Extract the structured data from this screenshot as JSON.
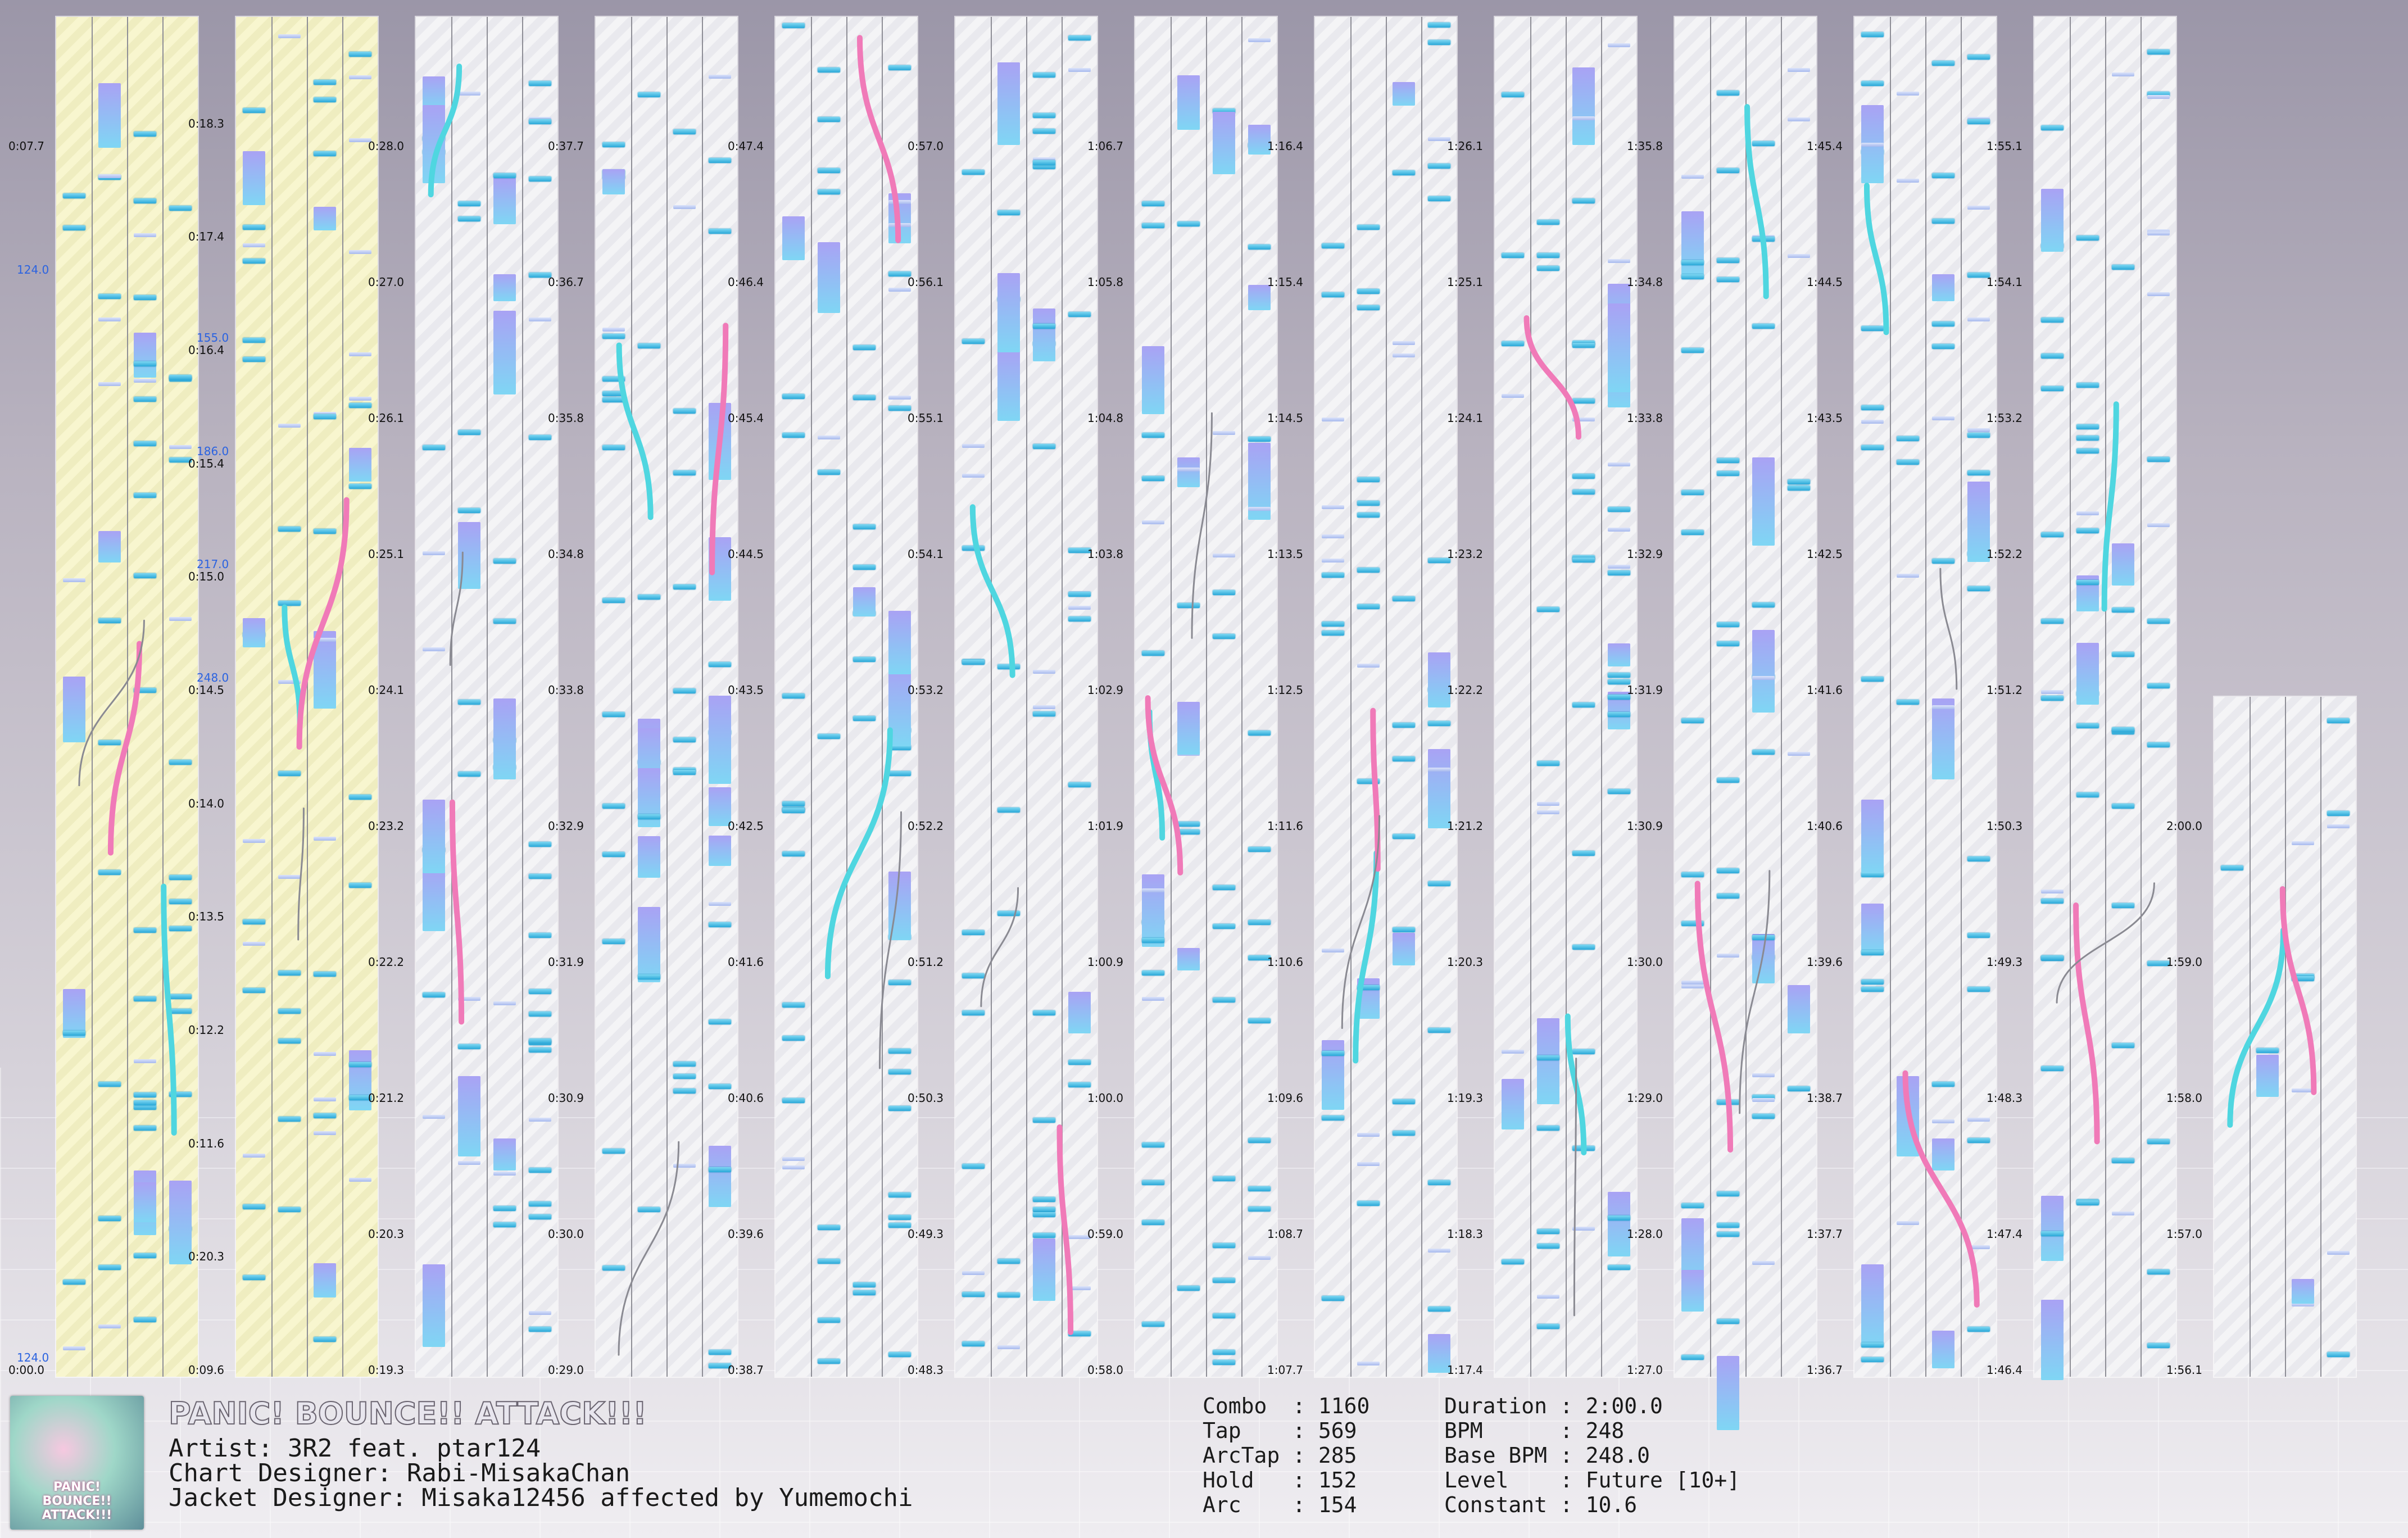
{
  "song": {
    "title": "PANIC! BOUNCE!! ATTACK!!!",
    "artist_line": "Artist: 3R2 feat. ptar124",
    "chart_designer_line": "Chart Designer: Rabi-MisakaChan",
    "jacket_designer_line": "Jacket Designer: Misaka12456 affected by Yumemochi",
    "jacket_text": "PANIC! BOUNCE!! ATTACK!!!"
  },
  "stats_left": [
    {
      "label": "Combo ",
      "value": "1160"
    },
    {
      "label": "Tap   ",
      "value": "569"
    },
    {
      "label": "ArcTap",
      "value": "285"
    },
    {
      "label": "Hold  ",
      "value": "152"
    },
    {
      "label": "Arc   ",
      "value": "154"
    }
  ],
  "stats_right": [
    {
      "label": "Duration",
      "value": "2:00.0"
    },
    {
      "label": "BPM     ",
      "value": "248"
    },
    {
      "label": "Base BPM",
      "value": "248.0"
    },
    {
      "label": "Level   ",
      "value": "Future [10+]"
    },
    {
      "label": "Constant",
      "value": "10.6"
    }
  ],
  "colors": {
    "tap": "#2aa8d8",
    "arc_blue": "#4fd6e0",
    "arc_pink": "#f07ab8",
    "bpm": "#2b63e0",
    "slow_section": "#f8f6cf"
  },
  "bpm_markers": [
    {
      "col": 0,
      "label": "124.0",
      "tick": 2
    },
    {
      "col": 0,
      "label": "124.0",
      "tick": 10
    },
    {
      "col": 1,
      "label": "248.0",
      "tick": 6
    },
    {
      "col": 1,
      "label": "217.0",
      "tick": 5
    },
    {
      "col": 1,
      "label": "186.0",
      "tick": 4
    },
    {
      "col": 1,
      "label": "155.0",
      "tick": 3
    }
  ],
  "columns": [
    {
      "labels": [
        "0:07.7",
        "",
        "",
        "",
        "",
        "",
        "",
        "",
        "",
        "0:00.0"
      ],
      "yellow": true
    },
    {
      "labels": [
        "0:18.3",
        "0:17.4",
        "0:16.4",
        "0:15.4",
        "0:15.0",
        "0:14.5",
        "0:14.0",
        "0:13.5",
        "0:12.2",
        "0:11.6",
        "0:20.3",
        "0:09.6"
      ],
      "yellow": true
    },
    {
      "labels": [
        "0:28.0",
        "0:27.0",
        "0:26.1",
        "0:25.1",
        "0:24.1",
        "0:23.2",
        "0:22.2",
        "0:21.2",
        "0:20.3",
        "0:19.3"
      ]
    },
    {
      "labels": [
        "0:37.7",
        "0:36.7",
        "0:35.8",
        "0:34.8",
        "0:33.8",
        "0:32.9",
        "0:31.9",
        "0:30.9",
        "0:30.0",
        "0:29.0"
      ]
    },
    {
      "labels": [
        "0:47.4",
        "0:46.4",
        "0:45.4",
        "0:44.5",
        "0:43.5",
        "0:42.5",
        "0:41.6",
        "0:40.6",
        "0:39.6",
        "0:38.7"
      ]
    },
    {
      "labels": [
        "0:57.0",
        "0:56.1",
        "0:55.1",
        "0:54.1",
        "0:53.2",
        "0:52.2",
        "0:51.2",
        "0:50.3",
        "0:49.3",
        "0:48.3"
      ]
    },
    {
      "labels": [
        "1:06.7",
        "1:05.8",
        "1:04.8",
        "1:03.8",
        "1:02.9",
        "1:01.9",
        "1:00.9",
        "1:00.0",
        "0:59.0",
        "0:58.0"
      ]
    },
    {
      "labels": [
        "1:16.4",
        "1:15.4",
        "1:14.5",
        "1:13.5",
        "1:12.5",
        "1:11.6",
        "1:10.6",
        "1:09.6",
        "1:08.7",
        "1:07.7"
      ]
    },
    {
      "labels": [
        "1:26.1",
        "1:25.1",
        "1:24.1",
        "1:23.2",
        "1:22.2",
        "1:21.2",
        "1:20.3",
        "1:19.3",
        "1:18.3",
        "1:17.4"
      ]
    },
    {
      "labels": [
        "1:35.8",
        "1:34.8",
        "1:33.8",
        "1:32.9",
        "1:31.9",
        "1:30.9",
        "1:30.0",
        "1:29.0",
        "1:28.0",
        "1:27.0"
      ]
    },
    {
      "labels": [
        "1:45.4",
        "1:44.5",
        "1:43.5",
        "1:42.5",
        "1:41.6",
        "1:40.6",
        "1:39.6",
        "1:38.7",
        "1:37.7",
        "1:36.7"
      ]
    },
    {
      "labels": [
        "1:55.1",
        "1:54.1",
        "1:53.2",
        "1:52.2",
        "1:51.2",
        "1:50.3",
        "1:49.3",
        "1:48.3",
        "1:47.4",
        "1:46.4"
      ]
    },
    {
      "labels": [
        "",
        "",
        "",
        "",
        "",
        "2:00.0",
        "1:59.0",
        "1:58.0",
        "1:57.0",
        "1:56.1"
      ],
      "partial": true
    }
  ]
}
